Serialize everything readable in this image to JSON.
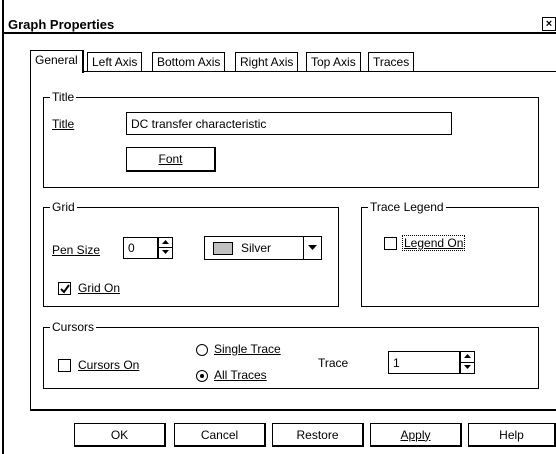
{
  "window": {
    "title": "Graph Properties",
    "close_label": "×"
  },
  "tabs": [
    {
      "label": "General",
      "active": true
    },
    {
      "label": "Left Axis",
      "active": false
    },
    {
      "label": "Bottom Axis",
      "active": false
    },
    {
      "label": "Right Axis",
      "active": false
    },
    {
      "label": "Top Axis",
      "active": false
    },
    {
      "label": "Traces",
      "active": false
    }
  ],
  "title_group": {
    "legend": "Title",
    "label": "Title",
    "value": "DC transfer characteristic",
    "font_button": "Font"
  },
  "grid_group": {
    "legend": "Grid",
    "pen_size_label": "Pen Size",
    "pen_size_value": "0",
    "color_value": "Silver",
    "color_swatch": "#c0c0c0",
    "grid_on_label": "Grid On",
    "grid_on_checked": true
  },
  "trace_legend_group": {
    "legend": "Trace Legend",
    "legend_on_label": "Legend On",
    "legend_on_checked": false
  },
  "cursors_group": {
    "legend": "Cursors",
    "cursors_on_label": "Cursors On",
    "cursors_on_checked": false,
    "single_trace_label": "Single Trace",
    "all_traces_label": "All Traces",
    "selected_mode": "All Traces",
    "trace_label": "Trace",
    "trace_value": "1"
  },
  "buttons": {
    "ok": "OK",
    "cancel": "Cancel",
    "restore": "Restore",
    "apply": "Apply",
    "help": "Help"
  }
}
